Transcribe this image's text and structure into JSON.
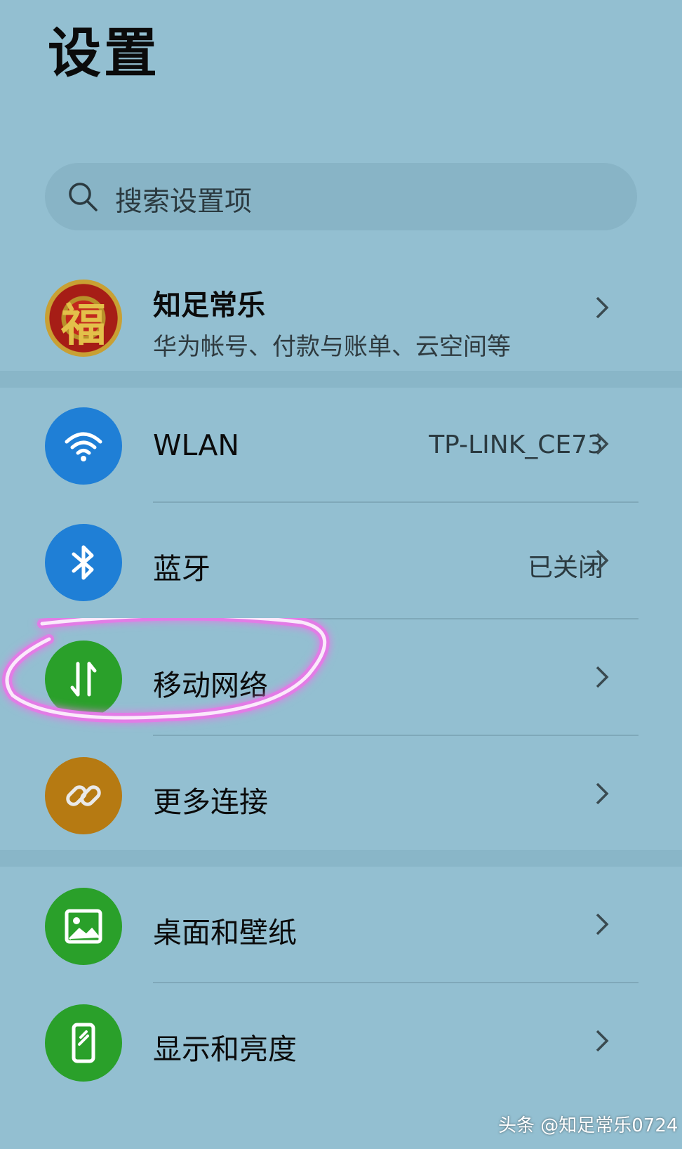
{
  "header": {
    "title": "设置"
  },
  "search": {
    "placeholder": "搜索设置项",
    "icon": "search-icon"
  },
  "account": {
    "name": "知足常乐",
    "subtitle": "华为帐号、付款与账单、云空间等",
    "avatar_glyph": "福"
  },
  "connections": [
    {
      "label": "WLAN",
      "value": "TP-LINK_CE73",
      "icon": "wifi-icon",
      "color": "#1f7fd6"
    },
    {
      "label": "蓝牙",
      "value": "已关闭",
      "icon": "bluetooth-icon",
      "color": "#1f7fd6"
    },
    {
      "label": "移动网络",
      "value": "",
      "icon": "mobile-data-icon",
      "color": "#2aa02a"
    },
    {
      "label": "更多连接",
      "value": "",
      "icon": "link-icon",
      "color": "#b67a12"
    }
  ],
  "display": [
    {
      "label": "桌面和壁纸",
      "icon": "wallpaper-icon",
      "color": "#2aa02a"
    },
    {
      "label": "显示和亮度",
      "icon": "phone-display-icon",
      "color": "#2aa02a"
    }
  ],
  "watermark": "头条 @知足常乐0724",
  "colors": {
    "background": "#93bfd1",
    "highlight": "#e27be6"
  }
}
